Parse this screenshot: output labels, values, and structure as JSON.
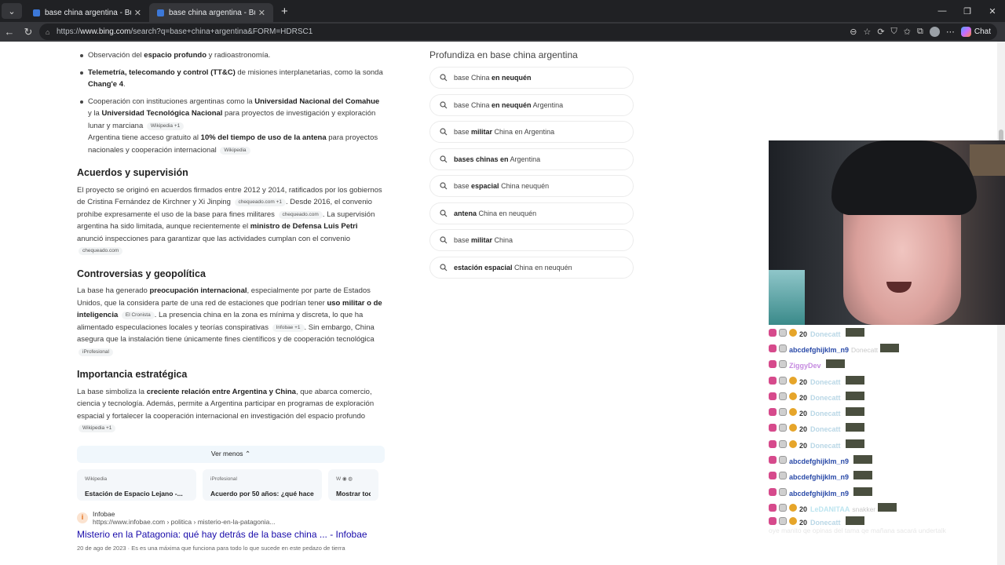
{
  "browser": {
    "tabs": [
      {
        "title": "base china argentina - Búsqueda",
        "active": false
      },
      {
        "title": "base china argentina - Búsqueda",
        "active": true
      }
    ],
    "url_prefix": "https://",
    "url_host": "www.bing.com",
    "url_path": "/search?q=base+china+argentina&FORM=HDRSC1",
    "chat_label": "Chat"
  },
  "answer": {
    "bullets": [
      {
        "pre": "Observación del ",
        "bold": "espacio profundo",
        "post": " y radioastronomía."
      },
      {
        "bold": "Telemetría, telecomando y control (TT&C)",
        "post": " de misiones interplanetarias, como la sonda ",
        "bold2": "Chang'e 4",
        "post2": "."
      },
      {
        "pre": "Cooperación con instituciones argentinas como la ",
        "bold": "Universidad Nacional del Comahue",
        "post": " y la ",
        "bold2": "Universidad Tecnológica Nacional",
        "post2": " para proyectos de investigación y exploración lunar y marciana",
        "cite": "Wikipedia +1",
        "extra_pre": "Argentina tiene acceso gratuito al ",
        "extra_bold": "10% del tiempo de uso de la antena",
        "extra_post": " para proyectos nacionales y cooperación internacional",
        "extra_cite": "Wikipedia"
      }
    ],
    "sections": [
      {
        "heading": "Acuerdos y supervisión",
        "p1": "El proyecto se originó en acuerdos firmados entre 2012 y 2014, ratificados por los gobiernos de Cristina Fernández de Kirchner y Xi Jinping",
        "c1": "chequeado.com +1",
        "p2": ". Desde 2016, el convenio prohíbe expresamente el uso de la base para fines militares",
        "c2": "chequeado.com",
        "p3": ". La supervisión argentina ha sido limitada, aunque recientemente el ",
        "b1": "ministro de Defensa Luis Petri",
        "p4": " anunció inspecciones para garantizar que las actividades cumplan con el convenio",
        "c3": "chequeado.com"
      },
      {
        "heading": "Controversias y geopolítica",
        "p1": "La base ha generado ",
        "b1": "preocupación internacional",
        "p2": ", especialmente por parte de Estados Unidos, que la considera parte de una red de estaciones que podrían tener ",
        "b2": "uso militar o de inteligencia",
        "c1": "El Cronista",
        "p3": ". La presencia china en la zona es mínima y discreta, lo que ha alimentado especulaciones locales y teorías conspirativas",
        "c2": "Infobae +1",
        "p4": ". Sin embargo, China asegura que la instalación tiene únicamente fines científicos y de cooperación tecnológica",
        "c3": "iProfesional"
      },
      {
        "heading": "Importancia estratégica",
        "p1": "La base simboliza la ",
        "b1": "creciente relación entre Argentina y China",
        "p2": ", que abarca comercio, ciencia y tecnología. Además, permite a Argentina participar en programas de exploración espacial y fortalecer la cooperación internacional en investigación del espacio profundo",
        "c1": "Wikipedia +1"
      }
    ],
    "ver_menos": "Ver menos",
    "source_cards": [
      {
        "source": "Wikipedia",
        "title": "Estación de Espacio Lejano -..."
      },
      {
        "source": "iProfesional",
        "title": "Acuerdo por 50 años: ¿qué hacen..."
      },
      {
        "source": "",
        "title": "Mostrar todo"
      }
    ],
    "result": {
      "site_name": "Infobae",
      "site_url": "https://www.infobae.com › politica › misterio-en-la-patagonia...",
      "title": "Misterio en la Patagonia: qué hay detrás de la base china ... - Infobae",
      "snippet": "20 de ago de 2023 · Es es una máxima que funciona para todo lo que sucede en este pedazo de tierra"
    }
  },
  "related": {
    "heading": "Profundiza en base china argentina",
    "items": [
      {
        "a": "base China ",
        "b": "en neuquén",
        "c": ""
      },
      {
        "a": "base China ",
        "b": "en neuquén",
        "c": " Argentina"
      },
      {
        "a": "base ",
        "b": "militar",
        "c": " China en Argentina"
      },
      {
        "a": "",
        "b": "bases chinas en",
        "c": " Argentina"
      },
      {
        "a": "base ",
        "b": "espacial",
        "c": " China neuquén"
      },
      {
        "a": "",
        "b": "antena",
        "c": " China en neuquén"
      },
      {
        "a": "base ",
        "b": "militar",
        "c": " China"
      },
      {
        "a": "",
        "b": "estación espacial",
        "c": " China en neuquén"
      }
    ]
  },
  "chat": {
    "messages": [
      {
        "points": "20",
        "user": "Donecatt",
        "user_style": "pale"
      },
      {
        "user": "abcdefghijklm_n9",
        "user_style": "blue",
        "text": "Donecatt"
      },
      {
        "user": "ZiggyDev",
        "user_style": "rain"
      },
      {
        "points": "20",
        "user": "Donecatt",
        "user_style": "pale"
      },
      {
        "points": "20",
        "user": "Donecatt",
        "user_style": "pale"
      },
      {
        "points": "20",
        "user": "Donecatt",
        "user_style": "pale"
      },
      {
        "points": "20",
        "user": "Donecatt",
        "user_style": "pale"
      },
      {
        "points": "20",
        "user": "Donecatt",
        "user_style": "pale"
      },
      {
        "user": "abcdefghijklm_n9",
        "user_style": "blue"
      },
      {
        "user": "abcdefghijklm_n9",
        "user_style": "blue"
      },
      {
        "user": "abcdefghijklm_n9",
        "user_style": "blue"
      },
      {
        "points": "20",
        "user": "LeDANITAA",
        "user_style": "teal",
        "text": "snakker"
      },
      {
        "points": "20",
        "user": "Donecatt",
        "user_style": "pale",
        "line2": "oye manito qe opinas del tama qe mañana sacará undertalk"
      }
    ]
  }
}
